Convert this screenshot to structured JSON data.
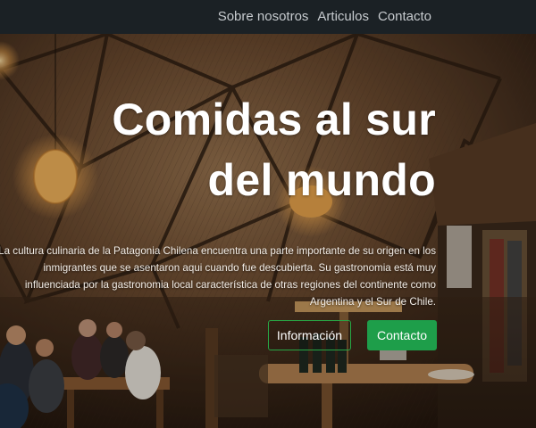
{
  "nav": {
    "items": [
      {
        "label": "Sobre nosotros"
      },
      {
        "label": "Articulos"
      },
      {
        "label": "Contacto"
      }
    ]
  },
  "hero": {
    "title_line1": "Comidas al sur",
    "title_line2": "del mundo",
    "description": "La cultura culinaria de la Patagonia Chilena encuentra una parte importante de su origen en los inmigrantes que se asentaron aqui cuando fue descubierta. Su gastronomia está muy influenciada por la gastronomia local característica de otras regiones del continente como Argentina y el Sur de Chile.",
    "buttons": {
      "info_label": "Información",
      "contact_label": "Contacto"
    }
  },
  "colors": {
    "navbar_bg": "#1b2125",
    "nav_text": "#c7cbcf",
    "accent_green": "#1e9e4a",
    "outline_green": "#28a745",
    "title_text": "#ffffff"
  }
}
